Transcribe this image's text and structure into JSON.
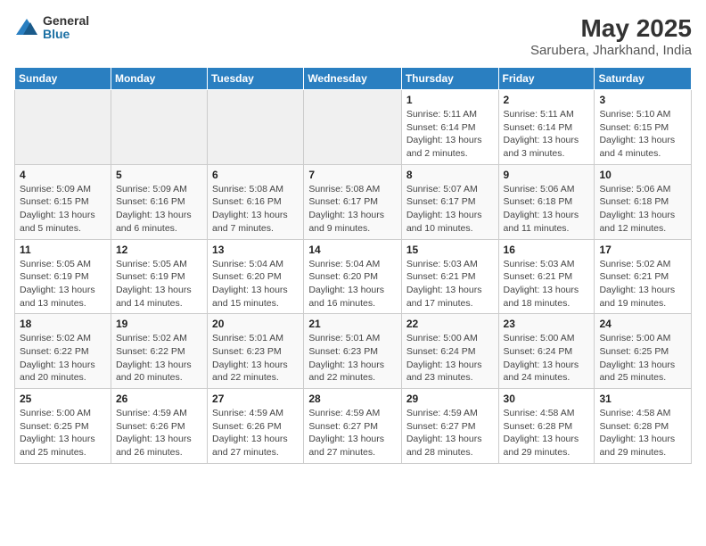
{
  "logo": {
    "general": "General",
    "blue": "Blue"
  },
  "title": "May 2025",
  "subtitle": "Sarubera, Jharkhand, India",
  "days_header": [
    "Sunday",
    "Monday",
    "Tuesday",
    "Wednesday",
    "Thursday",
    "Friday",
    "Saturday"
  ],
  "weeks": [
    [
      {
        "day": "",
        "info": ""
      },
      {
        "day": "",
        "info": ""
      },
      {
        "day": "",
        "info": ""
      },
      {
        "day": "",
        "info": ""
      },
      {
        "day": "1",
        "info": "Sunrise: 5:11 AM\nSunset: 6:14 PM\nDaylight: 13 hours and 2 minutes."
      },
      {
        "day": "2",
        "info": "Sunrise: 5:11 AM\nSunset: 6:14 PM\nDaylight: 13 hours and 3 minutes."
      },
      {
        "day": "3",
        "info": "Sunrise: 5:10 AM\nSunset: 6:15 PM\nDaylight: 13 hours and 4 minutes."
      }
    ],
    [
      {
        "day": "4",
        "info": "Sunrise: 5:09 AM\nSunset: 6:15 PM\nDaylight: 13 hours and 5 minutes."
      },
      {
        "day": "5",
        "info": "Sunrise: 5:09 AM\nSunset: 6:16 PM\nDaylight: 13 hours and 6 minutes."
      },
      {
        "day": "6",
        "info": "Sunrise: 5:08 AM\nSunset: 6:16 PM\nDaylight: 13 hours and 7 minutes."
      },
      {
        "day": "7",
        "info": "Sunrise: 5:08 AM\nSunset: 6:17 PM\nDaylight: 13 hours and 9 minutes."
      },
      {
        "day": "8",
        "info": "Sunrise: 5:07 AM\nSunset: 6:17 PM\nDaylight: 13 hours and 10 minutes."
      },
      {
        "day": "9",
        "info": "Sunrise: 5:06 AM\nSunset: 6:18 PM\nDaylight: 13 hours and 11 minutes."
      },
      {
        "day": "10",
        "info": "Sunrise: 5:06 AM\nSunset: 6:18 PM\nDaylight: 13 hours and 12 minutes."
      }
    ],
    [
      {
        "day": "11",
        "info": "Sunrise: 5:05 AM\nSunset: 6:19 PM\nDaylight: 13 hours and 13 minutes."
      },
      {
        "day": "12",
        "info": "Sunrise: 5:05 AM\nSunset: 6:19 PM\nDaylight: 13 hours and 14 minutes."
      },
      {
        "day": "13",
        "info": "Sunrise: 5:04 AM\nSunset: 6:20 PM\nDaylight: 13 hours and 15 minutes."
      },
      {
        "day": "14",
        "info": "Sunrise: 5:04 AM\nSunset: 6:20 PM\nDaylight: 13 hours and 16 minutes."
      },
      {
        "day": "15",
        "info": "Sunrise: 5:03 AM\nSunset: 6:21 PM\nDaylight: 13 hours and 17 minutes."
      },
      {
        "day": "16",
        "info": "Sunrise: 5:03 AM\nSunset: 6:21 PM\nDaylight: 13 hours and 18 minutes."
      },
      {
        "day": "17",
        "info": "Sunrise: 5:02 AM\nSunset: 6:21 PM\nDaylight: 13 hours and 19 minutes."
      }
    ],
    [
      {
        "day": "18",
        "info": "Sunrise: 5:02 AM\nSunset: 6:22 PM\nDaylight: 13 hours and 20 minutes."
      },
      {
        "day": "19",
        "info": "Sunrise: 5:02 AM\nSunset: 6:22 PM\nDaylight: 13 hours and 20 minutes."
      },
      {
        "day": "20",
        "info": "Sunrise: 5:01 AM\nSunset: 6:23 PM\nDaylight: 13 hours and 22 minutes."
      },
      {
        "day": "21",
        "info": "Sunrise: 5:01 AM\nSunset: 6:23 PM\nDaylight: 13 hours and 22 minutes."
      },
      {
        "day": "22",
        "info": "Sunrise: 5:00 AM\nSunset: 6:24 PM\nDaylight: 13 hours and 23 minutes."
      },
      {
        "day": "23",
        "info": "Sunrise: 5:00 AM\nSunset: 6:24 PM\nDaylight: 13 hours and 24 minutes."
      },
      {
        "day": "24",
        "info": "Sunrise: 5:00 AM\nSunset: 6:25 PM\nDaylight: 13 hours and 25 minutes."
      }
    ],
    [
      {
        "day": "25",
        "info": "Sunrise: 5:00 AM\nSunset: 6:25 PM\nDaylight: 13 hours and 25 minutes."
      },
      {
        "day": "26",
        "info": "Sunrise: 4:59 AM\nSunset: 6:26 PM\nDaylight: 13 hours and 26 minutes."
      },
      {
        "day": "27",
        "info": "Sunrise: 4:59 AM\nSunset: 6:26 PM\nDaylight: 13 hours and 27 minutes."
      },
      {
        "day": "28",
        "info": "Sunrise: 4:59 AM\nSunset: 6:27 PM\nDaylight: 13 hours and 27 minutes."
      },
      {
        "day": "29",
        "info": "Sunrise: 4:59 AM\nSunset: 6:27 PM\nDaylight: 13 hours and 28 minutes."
      },
      {
        "day": "30",
        "info": "Sunrise: 4:58 AM\nSunset: 6:28 PM\nDaylight: 13 hours and 29 minutes."
      },
      {
        "day": "31",
        "info": "Sunrise: 4:58 AM\nSunset: 6:28 PM\nDaylight: 13 hours and 29 minutes."
      }
    ]
  ]
}
